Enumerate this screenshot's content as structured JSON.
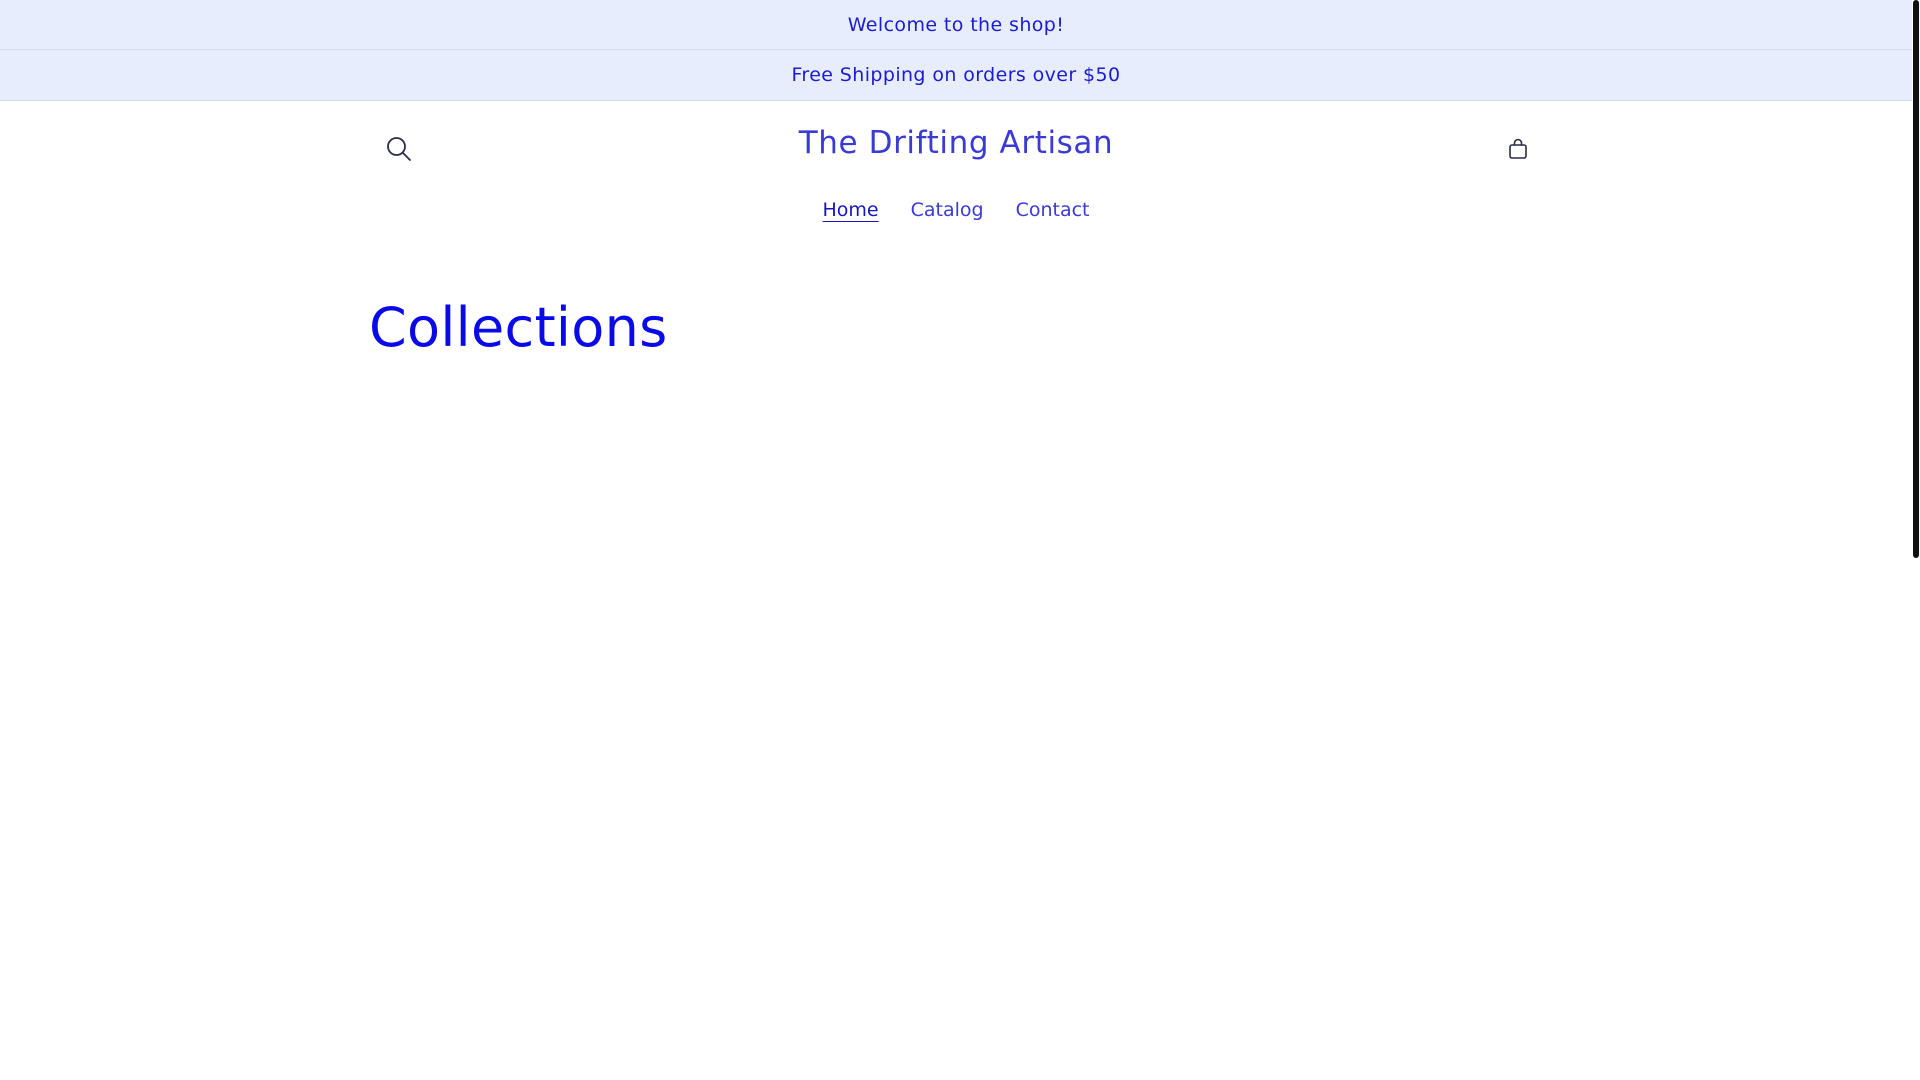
{
  "announcements": [
    {
      "text": "Welcome to the shop!"
    },
    {
      "text": "Free Shipping on orders over $50"
    }
  ],
  "header": {
    "store_name": "The Drifting Artisan",
    "search_icon": "search-icon",
    "cart_icon": "cart-icon"
  },
  "nav": {
    "items": [
      {
        "label": "Home",
        "active": true
      },
      {
        "label": "Catalog",
        "active": false
      },
      {
        "label": "Contact",
        "active": false
      }
    ]
  },
  "main": {
    "title": "Collections"
  },
  "colors": {
    "announcement_bg": "#e7edfd",
    "accent": "#3a3ad6",
    "title": "#0a0ae8"
  }
}
